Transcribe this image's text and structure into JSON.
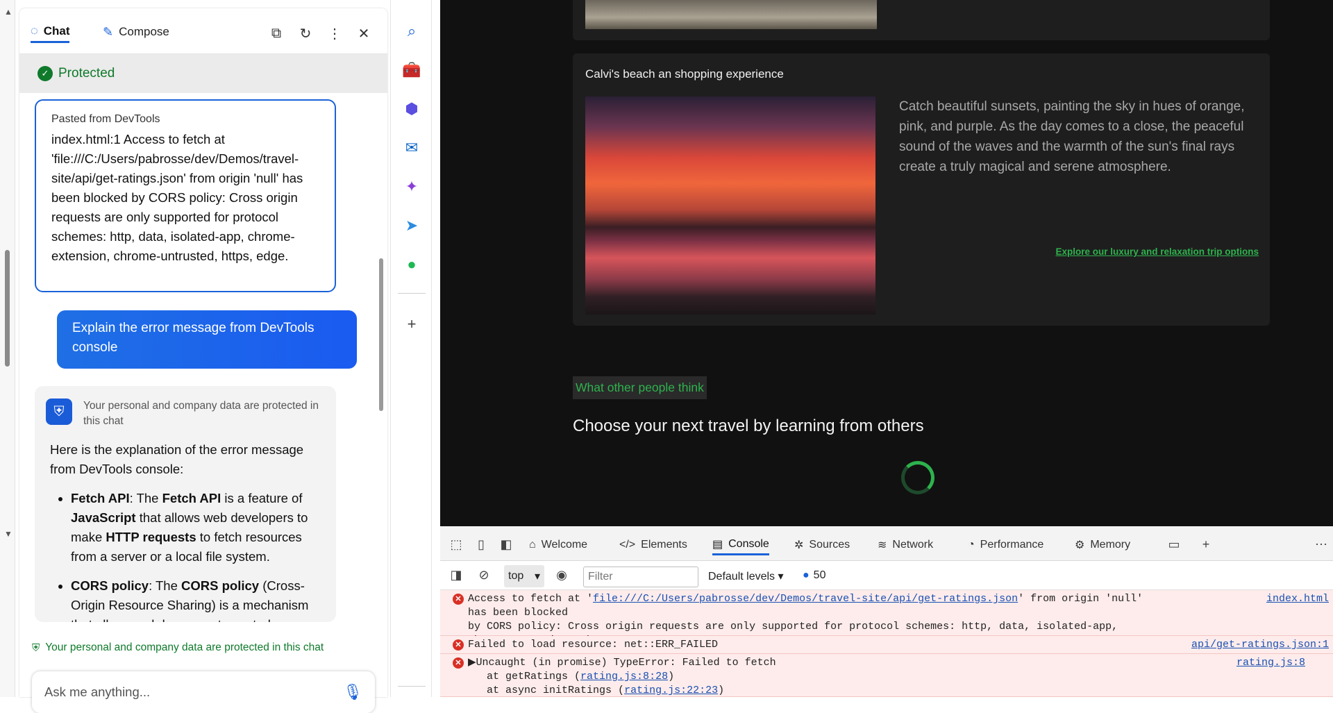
{
  "copilot": {
    "tabs": [
      {
        "label": "Chat"
      },
      {
        "label": "Compose"
      }
    ],
    "protected_label": "Protected",
    "pasted": {
      "source": "Pasted from DevTools",
      "text": "index.html:1 Access to fetch at 'file:///C:/Users/pabrosse/dev/Demos/travel-site/api/get-ratings.json' from origin 'null' has been blocked by CORS policy: Cross origin requests are only supported for protocol schemes: http, data, isolated-app, chrome-extension, chrome-untrusted, https, edge."
    },
    "user_message": "Explain the error message from DevTools console",
    "response": {
      "protection_note": "Your personal and company data are protected in this chat",
      "intro": "Here is the explanation of the error message from DevTools console:",
      "bullets": [
        {
          "term": "Fetch API",
          "rest_a": ": The ",
          "term2": "Fetch API",
          "rest_b": " is a feature of ",
          "term3": "JavaScript",
          "rest_c": " that allows web developers to make ",
          "term4": "HTTP requests",
          "rest_d": " to fetch resources from a server or a local file system."
        },
        {
          "term": "CORS policy",
          "rest_a": ": The ",
          "term2": "CORS policy",
          "rest_b": " (Cross-Origin Resource Sharing) is a mechanism that allows web browsers to control"
        }
      ]
    },
    "footer_note": "Your personal and company data are protected in this chat",
    "input_placeholder": "Ask me anything..."
  },
  "site": {
    "card_title": "Calvi's beach an shopping experience",
    "card_desc": "Catch beautiful sunsets, painting the sky in hues of orange, pink, and purple. As the day comes to a close, the peaceful sound of the waves and the warmth of the sun's final rays create a truly magical and serene atmosphere.",
    "card_link": "Explore our luxury and relaxation trip options",
    "people_tag": "What other people think",
    "people_heading": "Choose your next travel by learning from others"
  },
  "devtools": {
    "tabs": [
      {
        "label": "Welcome"
      },
      {
        "label": "Elements"
      },
      {
        "label": "Console"
      },
      {
        "label": "Sources"
      },
      {
        "label": "Network"
      },
      {
        "label": "Performance"
      },
      {
        "label": "Memory"
      }
    ],
    "context": "top",
    "filter_placeholder": "Filter",
    "levels": "Default levels",
    "issues_count": "50",
    "messages": [
      {
        "pre": "Access to fetch at '",
        "url": "file:///C:/Users/pabrosse/dev/Demos/travel-site/api/get-ratings.json",
        "post": "' from origin 'null' has been blocked\nby CORS policy: Cross origin requests are only supported for protocol schemes: http, data, isolated-app, chrome-extension, chrome-untrust\nhttps, edge.",
        "source": "index.html"
      },
      {
        "text": "Failed to load resource: net::ERR_FAILED",
        "source": "api/get-ratings.json:1"
      },
      {
        "line1": "▶Uncaught (in promise) TypeError: Failed to fetch",
        "line2_pre": "   at getRatings (",
        "line2_link": "rating.js:8:28",
        "line2_post": ")",
        "line3_pre": "   at async initRatings (",
        "line3_link": "rating.js:22:23",
        "line3_post": ")",
        "source": "rating.js:8"
      }
    ]
  }
}
